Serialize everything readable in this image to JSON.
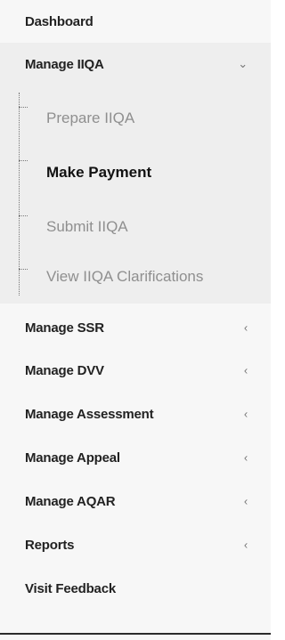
{
  "sidebar": {
    "items": [
      {
        "label": "Dashboard"
      },
      {
        "label": "Manage IIQA",
        "arrow": "⌄",
        "expanded": true
      },
      {
        "label": "Manage SSR",
        "arrow": "‹"
      },
      {
        "label": "Manage DVV",
        "arrow": "‹"
      },
      {
        "label": "Manage Assessment",
        "arrow": "‹"
      },
      {
        "label": "Manage Appeal",
        "arrow": "‹"
      },
      {
        "label": "Manage AQAR",
        "arrow": "‹"
      },
      {
        "label": "Reports",
        "arrow": "‹"
      },
      {
        "label": "Visit Feedback"
      }
    ],
    "submenu": [
      {
        "label": "Prepare IIQA"
      },
      {
        "label": "Make Payment",
        "active": true
      },
      {
        "label": "Submit IIQA"
      },
      {
        "label": "View IIQA Clarifications"
      }
    ]
  }
}
